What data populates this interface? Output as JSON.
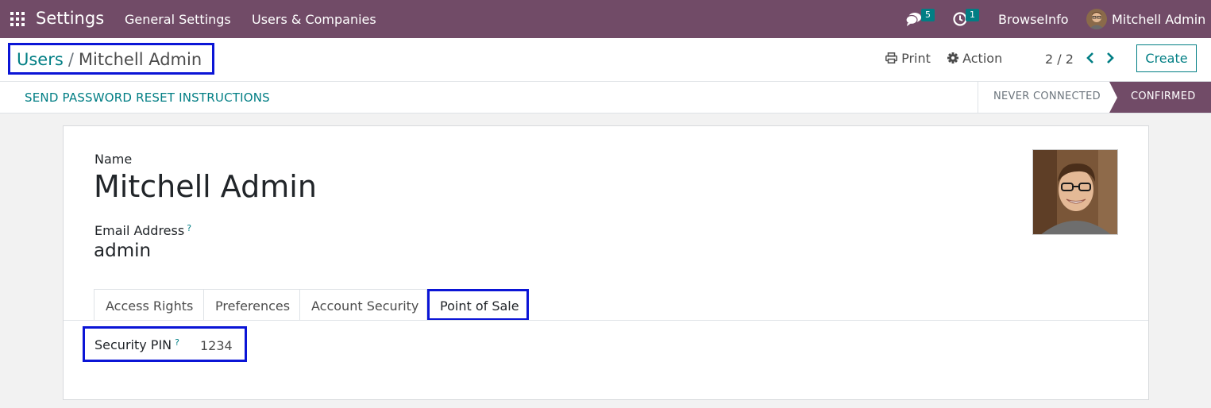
{
  "navbar": {
    "app_title": "Settings",
    "menu": [
      "General Settings",
      "Users & Companies"
    ],
    "messages_count": "5",
    "activities_count": "1",
    "company": "BrowseInfo",
    "user": "Mitchell Admin"
  },
  "control_panel": {
    "breadcrumb_parent": "Users",
    "breadcrumb_separator": "/",
    "breadcrumb_current": "Mitchell Admin",
    "print_label": "Print",
    "action_label": "Action",
    "pager": "2 / 2",
    "create_label": "Create"
  },
  "statusbar": {
    "reset_label": "SEND PASSWORD RESET INSTRUCTIONS",
    "stages": [
      "NEVER CONNECTED",
      "CONFIRMED"
    ],
    "active_stage": "CONFIRMED"
  },
  "form": {
    "name_label": "Name",
    "name_value": "Mitchell Admin",
    "email_label": "Email Address",
    "email_help": "?",
    "email_value": "admin",
    "tabs": [
      "Access Rights",
      "Preferences",
      "Account Security",
      "Point of Sale"
    ],
    "active_tab": "Point of Sale",
    "pin_label": "Security PIN",
    "pin_help": "?",
    "pin_value": "1234"
  },
  "colors": {
    "navbar": "#714b67",
    "accent": "#017e84",
    "highlight": "#0b15d6"
  },
  "icons": [
    "apps-grid-icon",
    "chat-icon",
    "clock-icon",
    "print-icon",
    "gear-icon",
    "chevron-left-icon",
    "chevron-right-icon"
  ]
}
